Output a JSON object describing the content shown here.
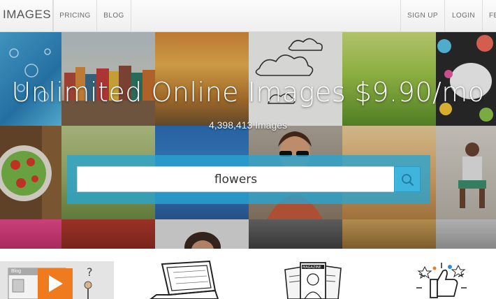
{
  "nav": {
    "brand": "IMAGES",
    "left_items": [
      "PRICING",
      "BLOG"
    ],
    "right_items": [
      "SIGN UP",
      "LOGIN",
      "FE"
    ]
  },
  "hero": {
    "headline": "Unlimited Online Images $9.90/mo",
    "image_count": "4,398,413 Images"
  },
  "search": {
    "value": "flowers",
    "icon": "search-icon"
  },
  "features": {
    "blog_tile_label": "Blog",
    "icons": [
      "blog-video-icon",
      "laptop-icon",
      "magazine-icon",
      "thumbs-up-icon"
    ]
  },
  "colors": {
    "search_band": "#26a5d2",
    "search_button": "#3fb4dc",
    "nav_text": "#6b6b6b",
    "play_button": "#f47b20"
  }
}
